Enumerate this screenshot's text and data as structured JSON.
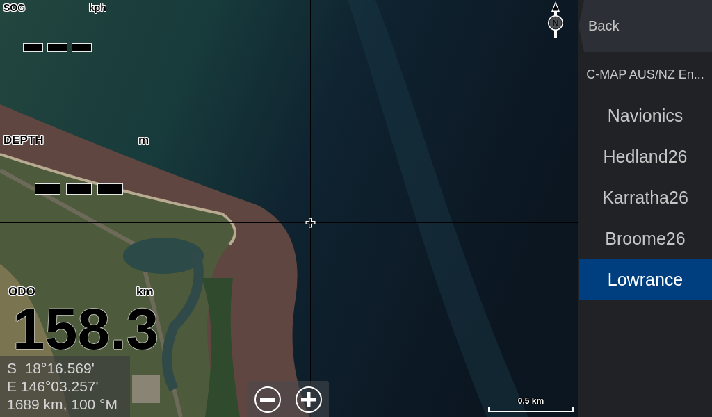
{
  "map": {
    "north_indicator": {
      "label": "N"
    },
    "scale_bar": {
      "label": "0.5 km"
    }
  },
  "gauges": [
    {
      "label": "SOG",
      "unit": "kph",
      "kind": "no-data"
    },
    {
      "label": "DEPTH",
      "unit": "m",
      "kind": "no-data"
    },
    {
      "label": "ODO",
      "unit": "km",
      "kind": "value",
      "value": "158.3"
    }
  ],
  "position": {
    "lines": [
      "S  18°16.569'",
      "E 146°03.257'",
      "1689 km, 100 °M"
    ]
  },
  "sidebar": {
    "back": {
      "label": "Back"
    },
    "items": [
      {
        "label": "C-MAP AUS/NZ En...",
        "selected": false
      },
      {
        "label": "Navionics",
        "selected": false
      },
      {
        "label": "Hedland26",
        "selected": false
      },
      {
        "label": "Karratha26",
        "selected": false
      },
      {
        "label": "Broome26",
        "selected": false
      },
      {
        "label": "Lowrance",
        "selected": true
      }
    ]
  }
}
